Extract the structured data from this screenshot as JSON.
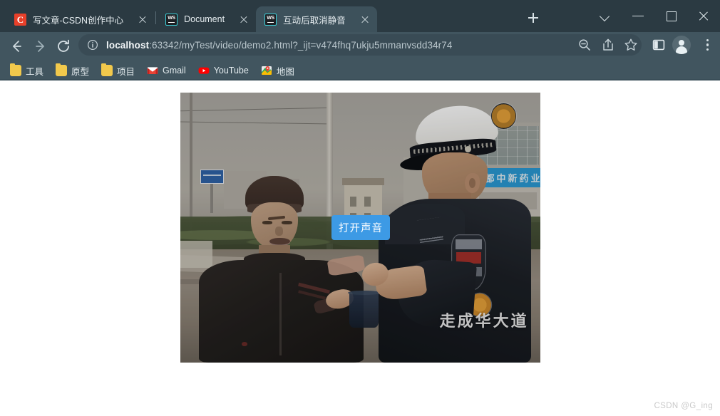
{
  "browser": {
    "tabs": [
      {
        "title": "写文章-CSDN创作中心",
        "favicon": "csdn-icon",
        "active": false
      },
      {
        "title": "Document",
        "favicon": "webstorm-icon",
        "active": false
      },
      {
        "title": "互动后取消静音",
        "favicon": "webstorm-icon",
        "active": true
      }
    ],
    "new_tab_label": "+",
    "window_controls": [
      {
        "name": "tab-search-chevron",
        "glyph": "⌄"
      },
      {
        "name": "minimize",
        "glyph": "—"
      },
      {
        "name": "maximize",
        "glyph": "□"
      },
      {
        "name": "close",
        "glyph": "✕"
      }
    ],
    "toolbar": {
      "back_label": "←",
      "forward_label": "→",
      "reload_label": "⟳",
      "site_info_label": "ⓘ",
      "url_host": "localhost",
      "url_rest": ":63342/myTest/video/demo2.html?_ijt=v474fhq7ukju5mmanvsdd34r74",
      "url_full": "localhost:63342/myTest/video/demo2.html?_ijt=v474fhq7ukju5mmanvsdd34r74",
      "icons": [
        {
          "name": "zoom-out-icon"
        },
        {
          "name": "share-icon"
        },
        {
          "name": "bookmark-star-icon"
        },
        {
          "name": "side-panel-icon"
        },
        {
          "name": "profile-avatar"
        },
        {
          "name": "chrome-menu-icon"
        }
      ]
    },
    "bookmarks": [
      {
        "label": "工具",
        "icon": "folder-icon"
      },
      {
        "label": "原型",
        "icon": "folder-icon"
      },
      {
        "label": "项目",
        "icon": "folder-icon"
      },
      {
        "label": "Gmail",
        "icon": "gmail-icon"
      },
      {
        "label": "YouTube",
        "icon": "youtube-icon"
      },
      {
        "label": "地图",
        "icon": "maps-icon"
      }
    ]
  },
  "page": {
    "video": {
      "unmute_button_label": "打开声音",
      "overlay_watermark": "走成华大道",
      "shop_sign_text": "成都中新药业"
    },
    "watermark": "CSDN @G_ing"
  },
  "colors": {
    "chrome_bg": "#41555f",
    "tabstrip_bg": "#2b3a42",
    "active_tab_bg": "#3d515b",
    "omnibox_bg": "#394b55",
    "button_blue": "#3d9ae5",
    "page_bg": "#ffffff"
  }
}
